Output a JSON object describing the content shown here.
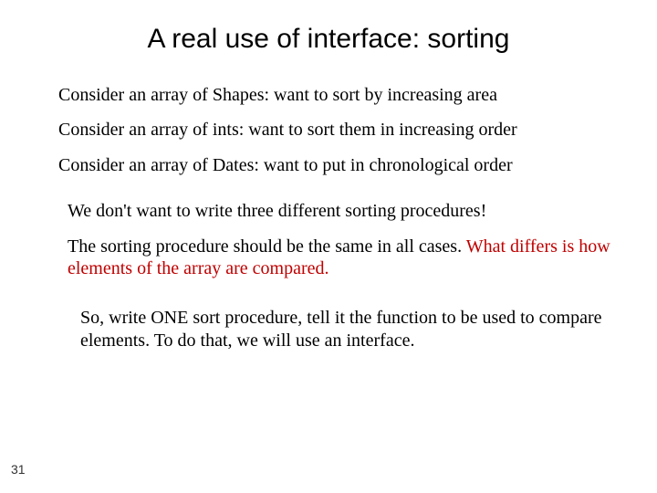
{
  "title": "A real use of interface: sorting",
  "lines": {
    "l1": "Consider an array of Shapes: want to sort by increasing area",
    "l2": "Consider an array of ints: want to sort them in increasing order",
    "l3": "Consider an array of Dates: want to put in chronological order",
    "l4": "We don't want to write three different sorting procedures!",
    "l5a": "The sorting procedure should be the same in all cases. ",
    "l5b": "What differs is how elements of the array are compared.",
    "l6": "So, write ONE sort procedure, tell it the function to be used to compare elements. To do that, we will use an interface."
  },
  "page_number": "31"
}
